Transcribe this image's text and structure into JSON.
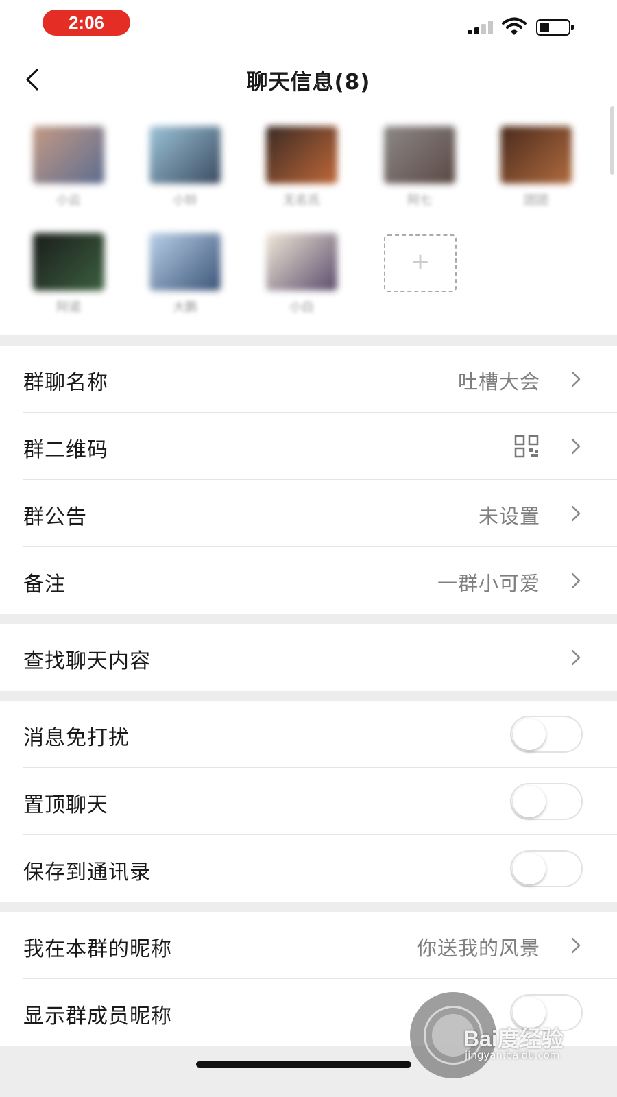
{
  "status_bar": {
    "time": "2:06",
    "time_pill_color": "#e42d24"
  },
  "nav": {
    "title": "聊天信息(8)",
    "back_icon": "chevron-left-icon"
  },
  "members": [
    {
      "name": "小云",
      "avatar_colors": [
        "#c49a84",
        "#5d6c90"
      ]
    },
    {
      "name": "小铃",
      "avatar_colors": [
        "#9cc4d8",
        "#3a4a60"
      ]
    },
    {
      "name": "无名氏",
      "avatar_colors": [
        "#3a2a24",
        "#c06838"
      ]
    },
    {
      "name": "阿七",
      "avatar_colors": [
        "#8c8888",
        "#5a4844"
      ]
    },
    {
      "name": "团团",
      "avatar_colors": [
        "#4a2a1c",
        "#b06c40"
      ]
    },
    {
      "name": "阿诺",
      "avatar_colors": [
        "#1a1c1a",
        "#3c6040"
      ]
    },
    {
      "name": "大鹏",
      "avatar_colors": [
        "#b8d0e8",
        "#3c5478"
      ]
    },
    {
      "name": "小白",
      "avatar_colors": [
        "#f0e8d8",
        "#5c4c6c"
      ]
    }
  ],
  "add_member": {
    "icon": "plus-icon",
    "label": "+"
  },
  "settings_group_1": [
    {
      "label": "群聊名称",
      "value": "吐槽大会"
    },
    {
      "label": "群二维码",
      "value": "",
      "icon": "qr-code-icon"
    },
    {
      "label": "群公告",
      "value": "未设置"
    },
    {
      "label": "备注",
      "value": "一群小可爱"
    }
  ],
  "search_row": {
    "label": "查找聊天内容"
  },
  "toggle_group": [
    {
      "label": "消息免打扰",
      "on": false
    },
    {
      "label": "置顶聊天",
      "on": false
    },
    {
      "label": "保存到通讯录",
      "on": false
    }
  ],
  "nickname_group": {
    "my_nickname": {
      "label": "我在本群的昵称",
      "value": "你送我的风景"
    },
    "show_nicknames": {
      "label": "显示群成员昵称",
      "on": false
    }
  },
  "watermark": {
    "brand": "Bai度经验",
    "url": "jingyan.baidu.com"
  },
  "colors": {
    "gap_background": "#ededed",
    "divider": "#e4e4e4",
    "value_text": "#7f7f7f"
  }
}
